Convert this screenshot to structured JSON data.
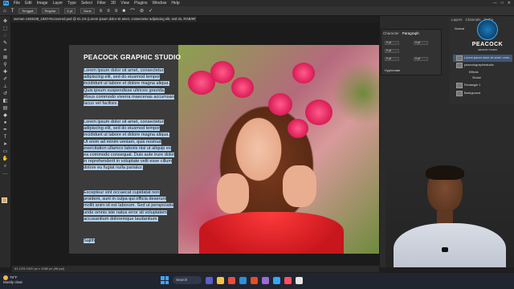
{
  "app": {
    "menu": [
      "File",
      "Edit",
      "Image",
      "Layer",
      "Type",
      "Select",
      "Filter",
      "3D",
      "View",
      "Plugins",
      "Window",
      "Help"
    ],
    "window_controls": [
      "—",
      "□",
      "✕"
    ]
  },
  "options_bar": {
    "font_family": "Tenggat",
    "font_style": "Regular",
    "font_size": "6 pt",
    "antialias": "None"
  },
  "document": {
    "tab_title": "woman-1463438_1920-Recovered.psd @ 61.1% (Lorem ipsum dolor sit amet, consectetur adipiscing elit, sed do, RGB/8#) *",
    "status": "61.13%   1920 px x 1080 px (96 ppi)"
  },
  "canvas": {
    "title": "PEACOCK GRAPHIC STUDIO",
    "paragraphs": [
      "Lorem ipsum dolor sit amet, consectetur adipiscing elit, sed do eiusmod tempor incididunt ut labore et dolore magna aliqua. Quis ipsum suspendisse ultrices gravida. Risus commodo viverra maecenas accumsan lacus vel facilisis.",
      "Lorem ipsum dolor sit amet, consectetur adipiscing elit, sed do eiusmod tempor incididunt ut labore et dolore magna aliqua. Ut enim ad minim veniam, quis nostrud exercitation ullamco laboris nisi ut aliquip ex ea commodo consequat. Duis aute irure dolor in reprehenderit in voluptate velit esse cillum dolore eu fugiat nulla pariatur.",
      "Excepteur sint occaecat cupidatat non proident, sunt in culpa qui officia deserunt mollit anim id est laborum. Sed ut perspiciatis unde omnis iste natus error sit voluptatem accusantium doloremque laudantium.",
      "Sajith"
    ]
  },
  "paragraph_panel": {
    "tabs": [
      "Character",
      "Paragraph"
    ],
    "active_tab": "Paragraph",
    "fields": [
      "0 pt",
      "0 pt",
      "0 pt",
      "0 pt",
      "0 pt"
    ],
    "hyphenate_label": "Hyphenate"
  },
  "layers_panel": {
    "tabs": [
      "Layers",
      "Channels",
      "Paths"
    ],
    "mode": "Normal",
    "rows": [
      {
        "label": "Lorem ipsum dolor sit amet, cons...",
        "selected": true
      },
      {
        "label": "peacockgraphicstudio",
        "selected": false
      },
      {
        "label": "Effects",
        "selected": false
      },
      {
        "label": "Stroke",
        "selected": false
      },
      {
        "label": "Rectangle 1",
        "selected": false
      },
      {
        "label": "Background",
        "selected": false
      }
    ]
  },
  "logo": {
    "text": "PEACOCK",
    "subtext": "GRAPHIC STUDIO"
  },
  "taskbar": {
    "temperature": "79°F",
    "weather": "Mostly clear",
    "search_label": "Search"
  },
  "colors": {
    "accent": "#31a8ff",
    "foreground_swatch": "#e8a33a",
    "text_highlight": "#b7d4f0"
  }
}
